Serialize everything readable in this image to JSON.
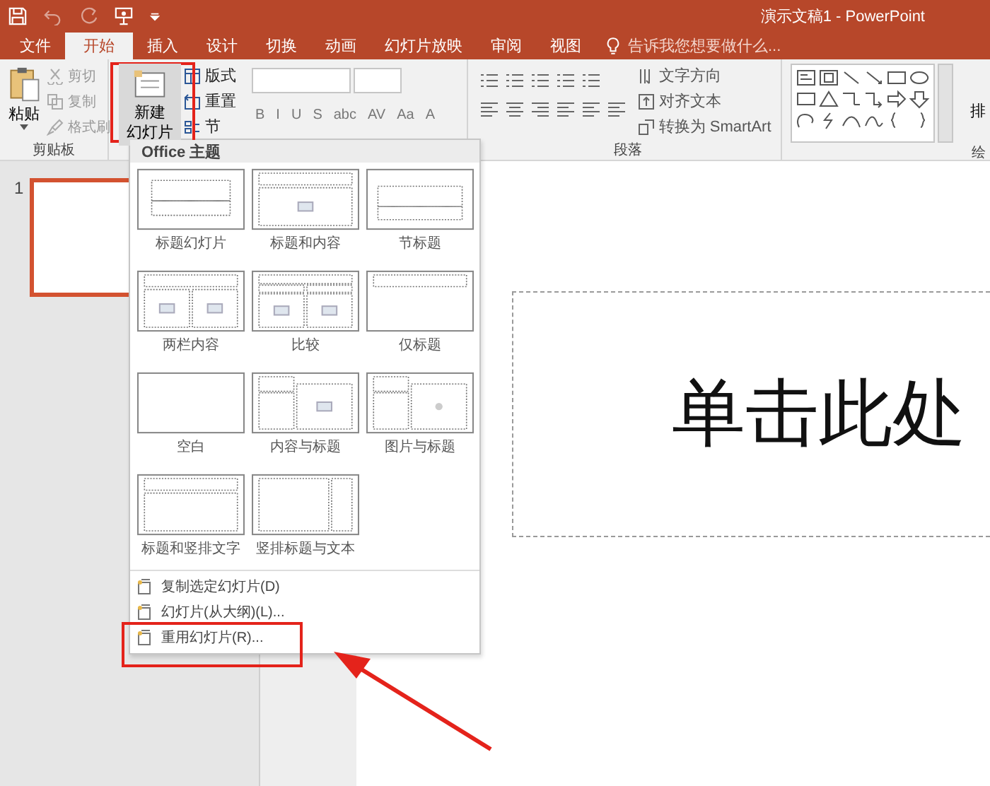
{
  "window": {
    "title": "演示文稿1 - PowerPoint"
  },
  "tabs": [
    {
      "label": "文件",
      "selected": false
    },
    {
      "label": "开始",
      "selected": true
    },
    {
      "label": "插入",
      "selected": false
    },
    {
      "label": "设计",
      "selected": false
    },
    {
      "label": "切换",
      "selected": false
    },
    {
      "label": "动画",
      "selected": false
    },
    {
      "label": "幻灯片放映",
      "selected": false
    },
    {
      "label": "审阅",
      "selected": false
    },
    {
      "label": "视图",
      "selected": false
    }
  ],
  "tell_me": {
    "placeholder": "告诉我您想要做什么..."
  },
  "clipboard": {
    "paste": "粘贴",
    "label": "剪贴板",
    "items": [
      {
        "label": "剪切",
        "disabled": true
      },
      {
        "label": "复制",
        "disabled": true
      },
      {
        "label": "格式刷",
        "disabled": true
      }
    ]
  },
  "slides_group": {
    "new_slide": [
      "新建",
      "幻灯片"
    ],
    "items": [
      "版式",
      "重置",
      "节"
    ]
  },
  "font": {
    "buttons": [
      "B",
      "I",
      "U",
      "S",
      "abc",
      "AV",
      "Aa",
      "A"
    ]
  },
  "paragraph": {
    "label": "段落",
    "items": [
      "文字方向",
      "对齐文本",
      "转换为 SmartArt"
    ]
  },
  "drawing": {
    "label": "绘",
    "arrange": "排"
  },
  "slide_panel": {
    "slides": [
      {
        "number": "1",
        "selected": true
      }
    ]
  },
  "slide": {
    "title_placeholder": "单击此处"
  },
  "layout_menu": {
    "header": "Office 主题",
    "layouts": [
      {
        "label": "标题幻灯片",
        "kind": "title"
      },
      {
        "label": "标题和内容",
        "kind": "title_content"
      },
      {
        "label": "节标题",
        "kind": "section"
      },
      {
        "label": "两栏内容",
        "kind": "two_content"
      },
      {
        "label": "比较",
        "kind": "comparison"
      },
      {
        "label": "仅标题",
        "kind": "title_only"
      },
      {
        "label": "空白",
        "kind": "blank"
      },
      {
        "label": "内容与标题",
        "kind": "content_caption"
      },
      {
        "label": "图片与标题",
        "kind": "picture_caption"
      },
      {
        "label": "标题和竖排文字",
        "kind": "title_vertical"
      },
      {
        "label": "竖排标题与文本",
        "kind": "vertical_title"
      }
    ],
    "items": [
      {
        "label": "复制选定幻灯片(D)"
      },
      {
        "label": "幻灯片(从大纲)(L)..."
      },
      {
        "label": "重用幻灯片(R)..."
      }
    ]
  }
}
